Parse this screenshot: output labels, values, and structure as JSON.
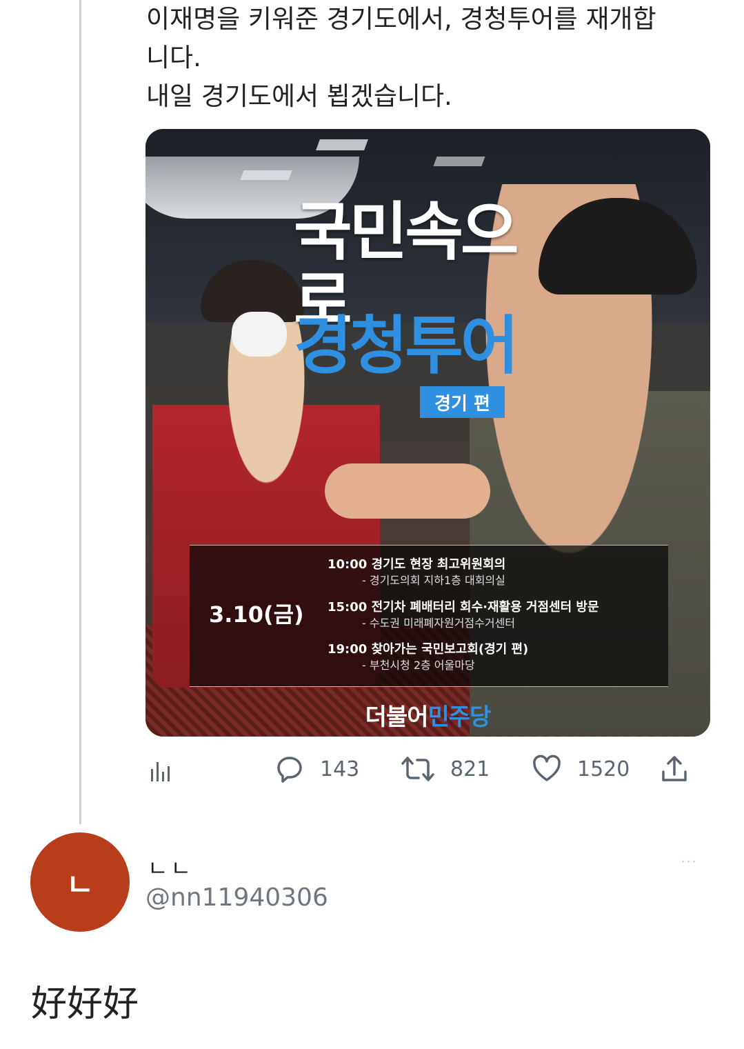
{
  "tweet": {
    "text_lines": [
      "이재명을 키워준 경기도에서, 경청투어를 재개합",
      "니다.",
      "내일 경기도에서 뵙겠습니다."
    ]
  },
  "image_card": {
    "headline_white": "국민속으로",
    "headline_blue": "경청투어",
    "edition": "경기 편",
    "date": "3.10(금)",
    "schedule": [
      {
        "main": "10:00 경기도 현장 최고위원회의",
        "sub": "- 경기도의회 지하1층 대회의실"
      },
      {
        "main": "15:00 전기차 폐배터리 회수·재활용 거점센터 방문",
        "sub": "- 수도권 미래폐자원거점수거센터"
      },
      {
        "main": "19:00 찾아가는 국민보고회(경기 편)",
        "sub": "- 부천시청 2층 어울마당"
      }
    ],
    "party_part1": "더불어",
    "party_part2": "민주당"
  },
  "actions": {
    "analytics_icon": "bar-chart-icon",
    "replies": "143",
    "retweets": "821",
    "likes": "1520",
    "share_icon": "share-icon"
  },
  "reply": {
    "avatar_letter": "ㄴ",
    "avatar_color": "#b83d1a",
    "name": "ㄴㄴ",
    "handle": "@nn11940306",
    "more": "···",
    "text": "好好好"
  }
}
